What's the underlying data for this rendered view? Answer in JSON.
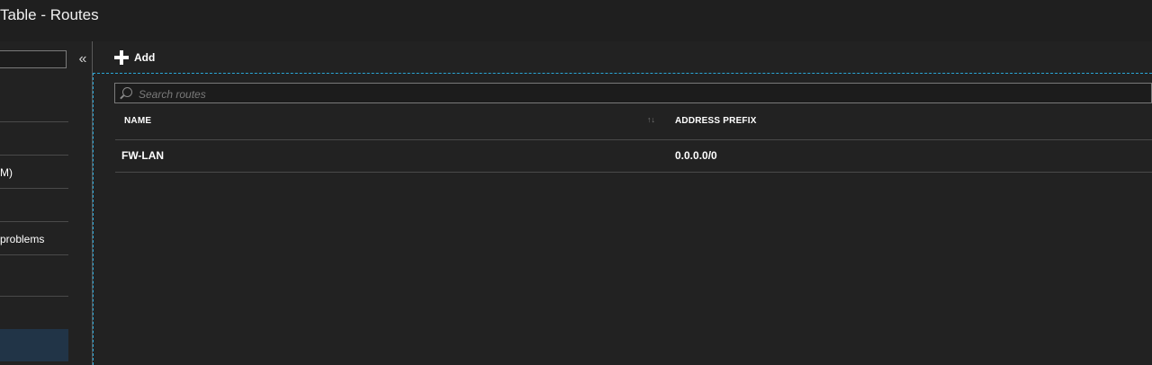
{
  "window": {
    "title": "Table - Routes"
  },
  "sidebar": {
    "items": [
      {
        "label": "M)"
      },
      {
        "label": " problems"
      }
    ]
  },
  "toolbar": {
    "add_label": "Add"
  },
  "search": {
    "placeholder": "Search routes"
  },
  "table": {
    "columns": [
      "NAME",
      "ADDRESS PREFIX"
    ],
    "rows": [
      {
        "name": "FW-LAN",
        "address_prefix": "0.0.0.0/0"
      }
    ]
  },
  "icons": {
    "collapse": "«",
    "sort": "↑↓"
  },
  "colors": {
    "background": "#222222",
    "focus_border": "#2aa7d8",
    "selected_item": "#213447"
  }
}
